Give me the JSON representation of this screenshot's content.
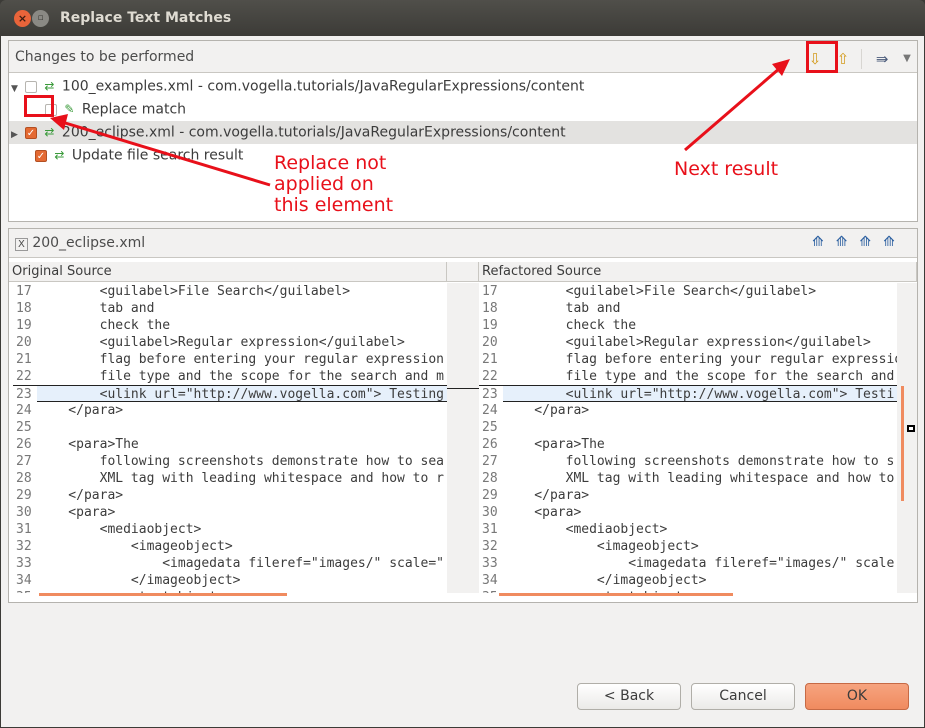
{
  "window": {
    "title": "Replace Text Matches",
    "close": "×",
    "minimize": "▫"
  },
  "changes": {
    "header": "Changes to be performed",
    "toolbar": {
      "next": "Next Change",
      "previous": "Previous Change",
      "filter": "Filter",
      "menu": "View Menu"
    },
    "rows": [
      {
        "label": "100_examples.xml - com.vogella.tutorials/JavaRegularExpressions/content",
        "checked": false,
        "expander": "▼"
      },
      {
        "label": "Replace match",
        "checked": false,
        "expander": ""
      },
      {
        "label": "200_eclipse.xml - com.vogella.tutorials/JavaRegularExpressions/content",
        "checked": true,
        "expander": "▶"
      },
      {
        "label": "Update file search result",
        "checked": true,
        "expander": ""
      }
    ]
  },
  "annotations": {
    "replace_not_applied": [
      "Replace not",
      "applied on",
      "this element"
    ],
    "next_result": "Next result"
  },
  "compare": {
    "file": "200_eclipse.xml",
    "left_title": "Original Source",
    "right_title": "Refactored Source",
    "highlight_line": 23,
    "left_lines": [
      [
        "17",
        "        <guilabel>File Search</guilabel>"
      ],
      [
        "18",
        "        tab and"
      ],
      [
        "19",
        "        check the"
      ],
      [
        "20",
        "        <guilabel>Regular expression</guilabel>"
      ],
      [
        "21",
        "        flag before entering your regular expression"
      ],
      [
        "22",
        "        file type and the scope for the search and m"
      ],
      [
        "23",
        "        <ulink url=\"http://www.vogella.com\"> Testing"
      ],
      [
        "24",
        "    </para>"
      ],
      [
        "25",
        ""
      ],
      [
        "26",
        "    <para>The"
      ],
      [
        "27",
        "        following screenshots demonstrate how to sea"
      ],
      [
        "28",
        "        XML tag with leading whitespace and how to r"
      ],
      [
        "29",
        "    </para>"
      ],
      [
        "30",
        "    <para>"
      ],
      [
        "31",
        "        <mediaobject>"
      ],
      [
        "32",
        "            <imageobject>"
      ],
      [
        "33",
        "                <imagedata fileref=\"images/\" scale=\""
      ],
      [
        "34",
        "            </imageobject>"
      ],
      [
        "35",
        "            <textobject>"
      ]
    ],
    "right_lines": [
      [
        "17",
        "        <guilabel>File Search</guilabel>"
      ],
      [
        "18",
        "        tab and"
      ],
      [
        "19",
        "        check the"
      ],
      [
        "20",
        "        <guilabel>Regular expression</guilabel>"
      ],
      [
        "21",
        "        flag before entering your regular expressio"
      ],
      [
        "22",
        "        file type and the scope for the search and"
      ],
      [
        "23",
        "        <ulink url=\"http://www.vogella.com\"> Testi"
      ],
      [
        "24",
        "    </para>"
      ],
      [
        "25",
        ""
      ],
      [
        "26",
        "    <para>The"
      ],
      [
        "27",
        "        following screenshots demonstrate how to s"
      ],
      [
        "28",
        "        XML tag with leading whitespace and how to"
      ],
      [
        "29",
        "    </para>"
      ],
      [
        "30",
        "    <para>"
      ],
      [
        "31",
        "        <mediaobject>"
      ],
      [
        "32",
        "            <imageobject>"
      ],
      [
        "33",
        "                <imagedata fileref=\"images/\" scale"
      ],
      [
        "34",
        "            </imageobject>"
      ],
      [
        "35",
        "            <textobject>"
      ]
    ]
  },
  "buttons": {
    "back": "< Back",
    "cancel": "Cancel",
    "ok": "OK"
  },
  "colors": {
    "accent": "#f08b5f",
    "annotation": "#e8101a"
  }
}
